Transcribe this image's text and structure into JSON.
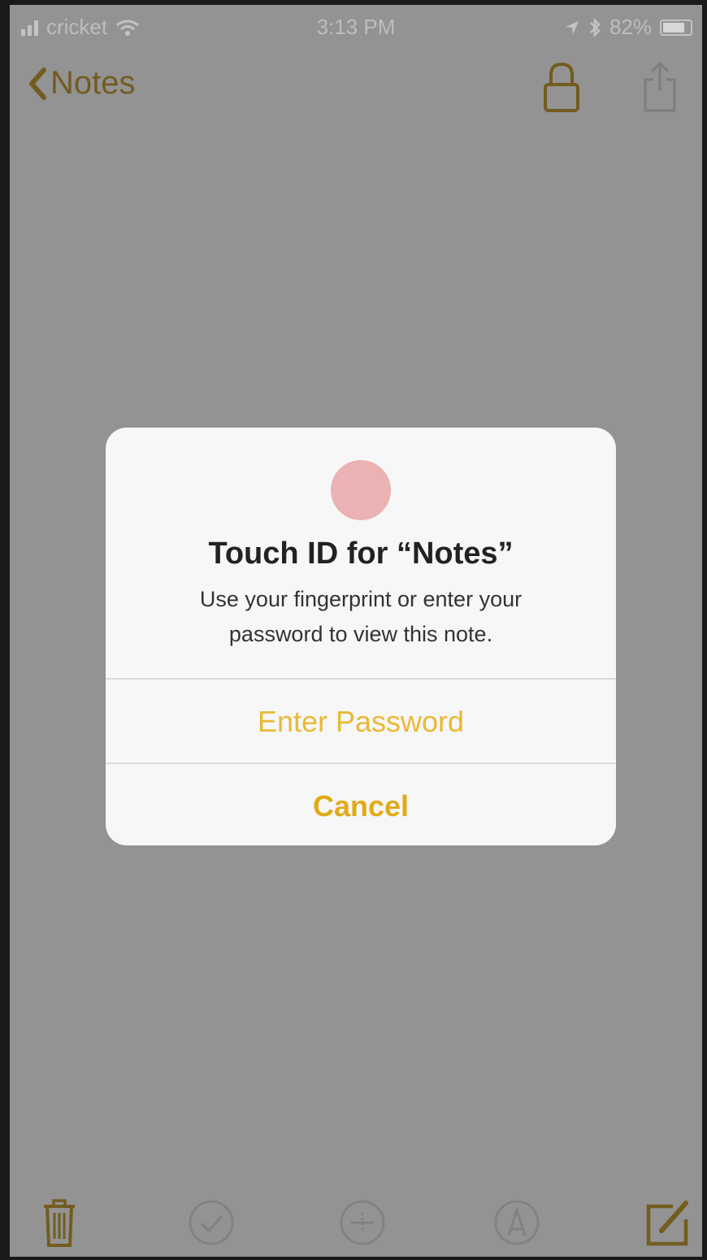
{
  "status_bar": {
    "carrier": "cricket",
    "time": "3:13 PM",
    "battery": "82%",
    "battery_level": 0.82,
    "icons": [
      "signal-icon",
      "wifi-icon",
      "location-icon",
      "bluetooth-icon",
      "battery-icon"
    ]
  },
  "nav": {
    "back_label": "Notes",
    "icons": [
      "chevron-left-icon",
      "lock-icon",
      "share-icon"
    ]
  },
  "dialog": {
    "title": "Touch ID for “Notes”",
    "message": "Use your fingerprint or enter your password to view this note.",
    "primary_button": "Enter Password",
    "cancel_button": "Cancel",
    "icon": "fingerprint-icon"
  },
  "toolbar": {
    "icons": [
      "trash-icon",
      "checklist-icon",
      "table-icon",
      "markup-icon",
      "compose-icon"
    ]
  },
  "colors": {
    "accent": "#e9b935",
    "dimmed_accent": "#735c20",
    "dim_overlay": "#939393",
    "dialog_bg": "#f7f7f7",
    "fingerprint": "#eab2b2"
  }
}
